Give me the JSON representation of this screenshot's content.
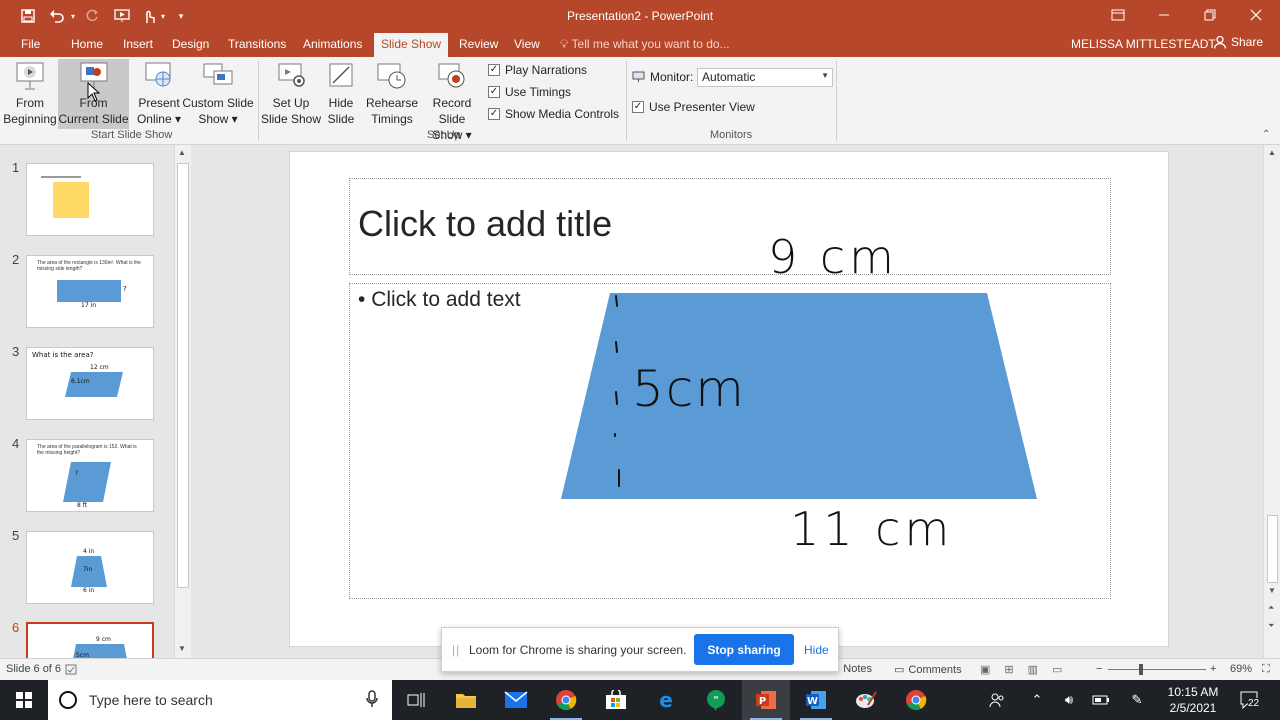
{
  "titlebar": {
    "title": "Presentation2 - PowerPoint",
    "accent": "#b7472a"
  },
  "tabs": [
    "File",
    "Home",
    "Insert",
    "Design",
    "Transitions",
    "Animations",
    "Slide Show",
    "Review",
    "View"
  ],
  "active_tab": "Slide Show",
  "tell_me": "Tell me what you want to do...",
  "user": "MELISSA MITTLESTEADT",
  "share": "Share",
  "ribbon": {
    "from_beginning": [
      "From",
      "Beginning"
    ],
    "from_current": [
      "From",
      "Current Slide"
    ],
    "present_online": [
      "Present",
      "Online ▾"
    ],
    "custom_show": [
      "Custom Slide",
      "Show ▾"
    ],
    "set_up": [
      "Set Up",
      "Slide Show"
    ],
    "hide_slide": [
      "Hide",
      "Slide"
    ],
    "rehearse": [
      "Rehearse",
      "Timings"
    ],
    "record": [
      "Record Slide",
      "Show ▾"
    ],
    "play_narrations": "Play Narrations",
    "use_timings": "Use Timings",
    "show_media_controls": "Show Media Controls",
    "monitor_label": "Monitor:",
    "monitor_value": "Automatic",
    "use_presenter_view": "Use Presenter View",
    "group_start": "Start Slide Show",
    "group_setup": "Set Up",
    "group_monitors": "Monitors"
  },
  "thumbnails": [
    {
      "num": "1"
    },
    {
      "num": "2",
      "text": "The area of the rectangle is 136in². What is the missing side length?",
      "q": "?",
      "b": "17 in"
    },
    {
      "num": "3",
      "text": "What is the area?",
      "top": "12 cm",
      "side": "6.1cm"
    },
    {
      "num": "4",
      "text": "The area of the parallelogram is 152. What is the missing height?",
      "q": "?",
      "b": "8 ft"
    },
    {
      "num": "5",
      "top": "4 in",
      "mid": "7in",
      "b": "6 in"
    },
    {
      "num": "6",
      "top": "9 cm",
      "mid": "5cm"
    }
  ],
  "slide": {
    "title_placeholder": "Click to add title",
    "body_placeholder": "Click to add text",
    "top_label": "9 cm",
    "height_label": "5cm",
    "bottom_label": "11 cm",
    "shape_color": "#5b9bd5"
  },
  "loom": {
    "message": "Loom for Chrome is sharing your screen.",
    "stop": "Stop sharing",
    "hide": "Hide"
  },
  "status": {
    "slide_count": "Slide 6 of 6",
    "notes": "Notes",
    "comments": "Comments",
    "zoom": "69%"
  },
  "taskbar": {
    "search_placeholder": "Type here to search",
    "time": "10:15 AM",
    "date": "2/5/2021",
    "notifications": "22"
  }
}
